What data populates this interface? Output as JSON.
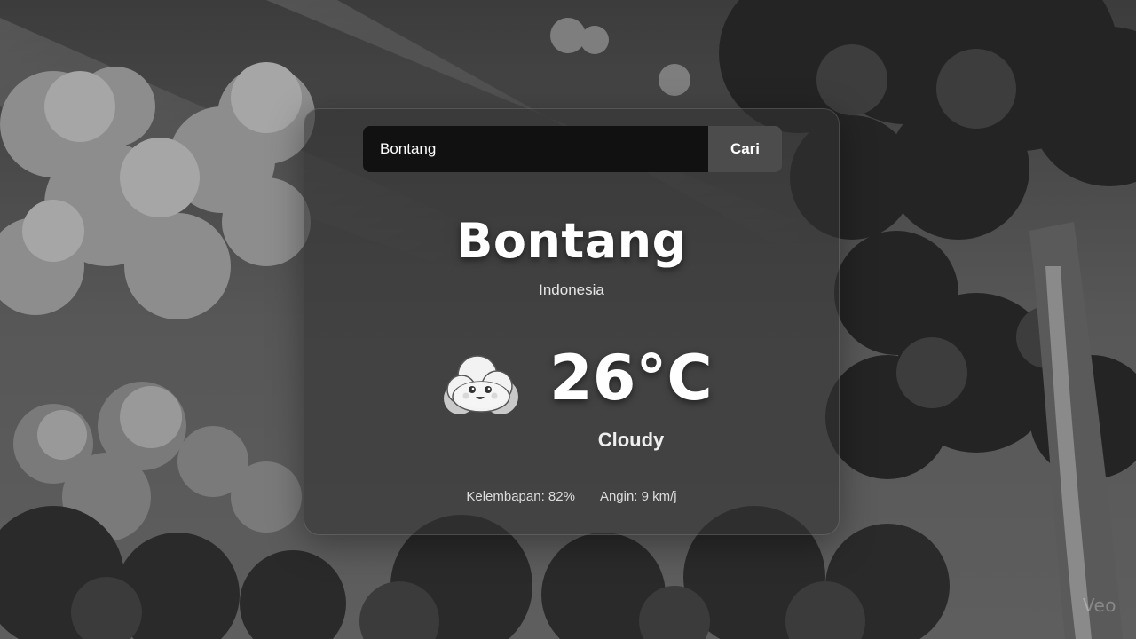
{
  "search": {
    "value": "Bontang",
    "placeholder": "",
    "button_label": "Cari"
  },
  "location": {
    "city": "Bontang",
    "country": "Indonesia"
  },
  "weather": {
    "icon": "cloud-icon",
    "temperature": "26°C",
    "condition": "Cloudy"
  },
  "details": {
    "humidity": "Kelembapan: 82%",
    "wind": "Angin: 9 km/j"
  },
  "watermark": "Veo",
  "colors": {
    "card_bg": "#3a3a3a",
    "search_bg": "#111111",
    "button_bg": "#4c4c4c",
    "text": "#ffffff"
  }
}
